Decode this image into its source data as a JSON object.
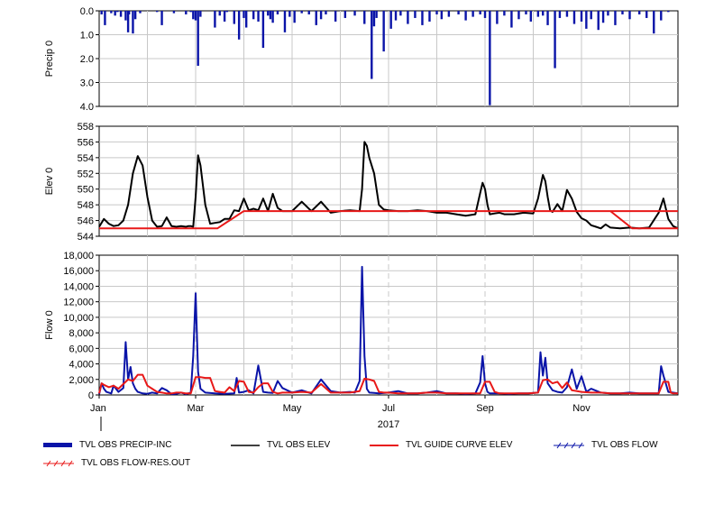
{
  "chart_data": {
    "type": "line",
    "x_tick_labels": [
      "Jan",
      "Mar",
      "May",
      "Jul",
      "Sep",
      "Nov"
    ],
    "year_label": "2017",
    "x_range_months": [
      0,
      12
    ],
    "panels": [
      {
        "id": "precip",
        "ylabel": "Precip 0",
        "y_tick_labels": [
          "0.0",
          "1.0",
          "2.0",
          "3.0",
          "4.0"
        ],
        "ylim": [
          0,
          4
        ],
        "inverted": true,
        "series": [
          {
            "name": "TVL OBS PRECIP-INC",
            "type": "bar",
            "color": "#0a14a8",
            "x": [
              0.05,
              0.12,
              0.25,
              0.33,
              0.38,
              0.45,
              0.55,
              0.6,
              0.62,
              0.7,
              0.75,
              0.85,
              1.2,
              1.3,
              1.55,
              1.8,
              1.9,
              1.95,
              2.0,
              2.05,
              2.1,
              2.4,
              2.5,
              2.6,
              2.65,
              2.8,
              2.9,
              3.0,
              3.05,
              3.2,
              3.3,
              3.4,
              3.5,
              3.55,
              3.6,
              3.7,
              3.85,
              3.95,
              4.05,
              4.2,
              4.35,
              4.5,
              4.6,
              4.7,
              4.9,
              5.1,
              5.3,
              5.5,
              5.65,
              5.7,
              5.75,
              5.9,
              6.05,
              6.15,
              6.25,
              6.4,
              6.55,
              6.7,
              6.85,
              7.0,
              7.1,
              7.25,
              7.45,
              7.6,
              7.75,
              7.9,
              8.0,
              8.1,
              8.25,
              8.4,
              8.55,
              8.7,
              8.85,
              8.95,
              9.1,
              9.2,
              9.3,
              9.45,
              9.55,
              9.7,
              9.85,
              10.0,
              10.1,
              10.2,
              10.35,
              10.45,
              10.55,
              10.7,
              10.85,
              11.0,
              11.2,
              11.35,
              11.5,
              11.65,
              11.8
            ],
            "values": [
              0.15,
              0.6,
              0.1,
              0.2,
              0.05,
              0.25,
              0.4,
              0.9,
              0.15,
              0.95,
              0.35,
              0.1,
              0.05,
              0.6,
              0.1,
              0.15,
              0.05,
              0.35,
              0.4,
              2.3,
              0.25,
              0.7,
              0.2,
              0.45,
              0.05,
              0.55,
              1.2,
              0.3,
              0.7,
              0.35,
              0.45,
              1.55,
              0.2,
              0.35,
              0.5,
              0.15,
              0.9,
              0.25,
              0.5,
              0.1,
              0.15,
              0.6,
              0.35,
              0.15,
              0.45,
              0.3,
              0.2,
              0.55,
              2.85,
              0.65,
              0.3,
              1.7,
              0.75,
              0.4,
              0.2,
              0.55,
              0.3,
              0.6,
              0.45,
              0.15,
              0.35,
              0.25,
              0.15,
              0.4,
              0.25,
              0.15,
              0.3,
              3.95,
              0.55,
              0.2,
              0.7,
              0.35,
              0.15,
              0.45,
              0.25,
              0.2,
              0.6,
              2.4,
              0.3,
              0.25,
              0.55,
              0.45,
              0.75,
              0.35,
              0.8,
              0.5,
              0.2,
              0.6,
              0.15,
              0.35,
              0.15,
              0.3,
              0.95,
              0.4,
              0.05
            ]
          }
        ]
      },
      {
        "id": "elev",
        "ylabel": "Elev 0",
        "y_tick_labels": [
          "544",
          "546",
          "548",
          "550",
          "552",
          "554",
          "556",
          "558"
        ],
        "ylim": [
          544,
          558
        ],
        "series": [
          {
            "name": "TVL OBS ELEV",
            "color": "#000000",
            "x": [
              0,
              0.1,
              0.2,
              0.3,
              0.4,
              0.5,
              0.6,
              0.7,
              0.8,
              0.9,
              1.0,
              1.1,
              1.2,
              1.3,
              1.4,
              1.5,
              1.6,
              1.7,
              1.8,
              1.85,
              1.9,
              1.95,
              2.0,
              2.05,
              2.1,
              2.2,
              2.3,
              2.4,
              2.5,
              2.6,
              2.7,
              2.8,
              2.9,
              3.0,
              3.1,
              3.2,
              3.3,
              3.4,
              3.5,
              3.6,
              3.7,
              3.8,
              3.9,
              4.0,
              4.2,
              4.4,
              4.6,
              4.8,
              5.0,
              5.2,
              5.4,
              5.45,
              5.5,
              5.55,
              5.6,
              5.7,
              5.8,
              5.9,
              6.0,
              6.2,
              6.4,
              6.6,
              6.8,
              7.0,
              7.2,
              7.4,
              7.6,
              7.8,
              7.9,
              7.95,
              8.0,
              8.05,
              8.1,
              8.2,
              8.3,
              8.4,
              8.6,
              8.8,
              9.0,
              9.1,
              9.2,
              9.25,
              9.3,
              9.35,
              9.4,
              9.5,
              9.6,
              9.7,
              9.8,
              9.9,
              10.0,
              10.1,
              10.2,
              10.3,
              10.4,
              10.5,
              10.6,
              10.8,
              11.0,
              11.2,
              11.4,
              11.6,
              11.7,
              11.8,
              11.9,
              12.0
            ],
            "values": [
              545.2,
              546.2,
              545.6,
              545.3,
              545.4,
              546.0,
              548.0,
              552.0,
              554.2,
              553.0,
              549.0,
              546.0,
              545.2,
              545.3,
              546.4,
              545.3,
              545.2,
              545.3,
              545.2,
              545.3,
              545.3,
              545.2,
              549.0,
              554.3,
              553.0,
              548.0,
              545.6,
              545.7,
              545.8,
              546.2,
              546.2,
              547.3,
              547.2,
              548.8,
              547.3,
              547.5,
              547.3,
              548.8,
              547.2,
              549.4,
              547.6,
              547.2,
              547.2,
              547.2,
              548.4,
              547.2,
              548.4,
              547.0,
              547.2,
              547.3,
              547.2,
              550.0,
              556.0,
              555.5,
              554.0,
              552.0,
              548.0,
              547.4,
              547.3,
              547.2,
              547.2,
              547.3,
              547.2,
              547.0,
              547.0,
              546.8,
              546.6,
              546.8,
              549.5,
              550.8,
              550.0,
              548.0,
              546.8,
              546.9,
              547.0,
              546.8,
              546.8,
              547.0,
              546.9,
              548.8,
              551.8,
              551.0,
              549.0,
              547.3,
              547.1,
              548.1,
              547.2,
              549.9,
              548.8,
              547.1,
              546.3,
              546.0,
              545.4,
              545.2,
              545.0,
              545.5,
              545.1,
              545.0,
              545.1,
              545.0,
              545.1,
              547.0,
              548.8,
              546.2,
              545.3,
              545.0
            ],
            "line_width": 2
          },
          {
            "name": "TVL GUIDE CURVE ELEV",
            "color": "#e81818",
            "x": [
              0,
              2.45,
              3.0,
              12.0
            ],
            "values": [
              545.0,
              545.0,
              547.2,
              547.2
            ],
            "tail_x": [
              10.6,
              11.05,
              12.0
            ],
            "tail_values": [
              547.2,
              545.0,
              545.0
            ],
            "line_width": 2
          }
        ]
      },
      {
        "id": "flow",
        "ylabel": "Flow 0",
        "y_tick_labels": [
          "0",
          "2,000",
          "4,000",
          "6,000",
          "8,000",
          "10,000",
          "12,000",
          "14,000",
          "16,000",
          "18,000"
        ],
        "ylim": [
          0,
          18000
        ],
        "series": [
          {
            "name": "TVL OBS FLOW",
            "color": "#0a14a8",
            "x": [
              0,
              0.05,
              0.1,
              0.15,
              0.2,
              0.25,
              0.3,
              0.4,
              0.5,
              0.55,
              0.6,
              0.65,
              0.7,
              0.75,
              0.8,
              0.9,
              1.0,
              1.1,
              1.2,
              1.3,
              1.4,
              1.5,
              1.6,
              1.7,
              1.8,
              1.9,
              1.95,
              2.0,
              2.05,
              2.1,
              2.2,
              2.4,
              2.6,
              2.8,
              2.85,
              2.9,
              3.0,
              3.1,
              3.2,
              3.3,
              3.4,
              3.5,
              3.6,
              3.7,
              3.8,
              4.0,
              4.2,
              4.4,
              4.6,
              4.8,
              5.0,
              5.2,
              5.3,
              5.4,
              5.45,
              5.5,
              5.55,
              5.6,
              5.7,
              5.8,
              6.0,
              6.2,
              6.4,
              6.6,
              6.8,
              7.0,
              7.2,
              7.4,
              7.6,
              7.8,
              7.9,
              7.95,
              8.0,
              8.05,
              8.1,
              8.3,
              8.5,
              8.7,
              8.9,
              9.0,
              9.1,
              9.15,
              9.2,
              9.25,
              9.3,
              9.4,
              9.5,
              9.6,
              9.7,
              9.8,
              9.9,
              10.0,
              10.1,
              10.2,
              10.4,
              10.6,
              10.8,
              11.0,
              11.2,
              11.4,
              11.6,
              11.65,
              11.7,
              11.8,
              12.0
            ],
            "values": [
              100,
              1500,
              800,
              400,
              300,
              200,
              1200,
              400,
              900,
              6800,
              2000,
              3600,
              1500,
              800,
              400,
              200,
              150,
              300,
              200,
              900,
              600,
              100,
              150,
              300,
              100,
              300,
              5000,
              13100,
              3000,
              800,
              300,
              200,
              150,
              200,
              2200,
              300,
              400,
              600,
              200,
              3800,
              400,
              300,
              250,
              1800,
              900,
              300,
              600,
              200,
              2000,
              500,
              300,
              400,
              300,
              1800,
              16500,
              5000,
              800,
              300,
              250,
              200,
              300,
              500,
              200,
              200,
              300,
              500,
              200,
              200,
              150,
              200,
              1600,
              5000,
              1500,
              400,
              200,
              200,
              150,
              200,
              200,
              250,
              300,
              5500,
              2500,
              4800,
              1500,
              600,
              400,
              300,
              1000,
              3300,
              800,
              2400,
              400,
              800,
              300,
              200,
              200,
              300,
              200,
              200,
              200,
              3700,
              2500,
              400,
              200
            ],
            "line_width": 2
          },
          {
            "name": "TVL OBS FLOW-RES.OUT",
            "color": "#e81818",
            "x": [
              0,
              0.05,
              0.1,
              0.2,
              0.3,
              0.4,
              0.5,
              0.6,
              0.7,
              0.8,
              0.9,
              1.0,
              1.1,
              1.2,
              1.3,
              1.4,
              1.5,
              1.6,
              1.7,
              1.8,
              1.9,
              2.0,
              2.05,
              2.1,
              2.2,
              2.3,
              2.4,
              2.5,
              2.6,
              2.7,
              2.8,
              2.9,
              3.0,
              3.1,
              3.2,
              3.3,
              3.4,
              3.5,
              3.6,
              3.7,
              3.8,
              4.0,
              4.2,
              4.4,
              4.6,
              4.8,
              5.0,
              5.2,
              5.4,
              5.5,
              5.6,
              5.7,
              5.8,
              5.9,
              6.0,
              6.2,
              6.4,
              6.6,
              6.8,
              7.0,
              7.2,
              7.4,
              7.6,
              7.8,
              7.9,
              8.0,
              8.1,
              8.2,
              8.3,
              8.5,
              8.7,
              8.9,
              9.1,
              9.2,
              9.3,
              9.4,
              9.5,
              9.6,
              9.7,
              9.8,
              10.0,
              10.2,
              10.4,
              10.6,
              10.8,
              11.0,
              11.2,
              11.4,
              11.6,
              11.7,
              11.75,
              11.8,
              11.85,
              11.9,
              12.0
            ],
            "values": [
              200,
              1500,
              1300,
              1000,
              1200,
              800,
              1400,
              2000,
              1800,
              2600,
              2600,
              1200,
              800,
              400,
              300,
              200,
              200,
              300,
              300,
              200,
              200,
              2300,
              2300,
              2300,
              2200,
              2200,
              500,
              400,
              300,
              1000,
              500,
              1800,
              1700,
              400,
              300,
              1000,
              1500,
              1500,
              400,
              200,
              300,
              300,
              400,
              300,
              1400,
              300,
              300,
              300,
              500,
              2100,
              2000,
              1800,
              400,
              300,
              300,
              200,
              200,
              200,
              300,
              300,
              200,
              200,
              200,
              200,
              200,
              1700,
              1700,
              400,
              200,
              200,
              200,
              200,
              300,
              1900,
              2000,
              1500,
              1700,
              900,
              1600,
              600,
              400,
              300,
              300,
              200,
              200,
              200,
              200,
              200,
              200,
              1700,
              1700,
              1700,
              300,
              200,
              200
            ],
            "line_width": 2
          }
        ]
      }
    ],
    "legend": [
      {
        "name": "TVL OBS PRECIP-INC",
        "style": "thick-line",
        "color": "#0a14a8"
      },
      {
        "name": "TVL OBS ELEV",
        "style": "line",
        "color": "#000000"
      },
      {
        "name": "TVL GUIDE CURVE ELEV",
        "style": "line",
        "color": "#e81818"
      },
      {
        "name": "TVL OBS FLOW",
        "style": "hatched-line",
        "color": "#0a14a8"
      },
      {
        "name": "TVL OBS FLOW-RES.OUT",
        "style": "hatched-line",
        "color": "#e81818"
      }
    ],
    "legend_placement": "bottom",
    "grid": true
  }
}
